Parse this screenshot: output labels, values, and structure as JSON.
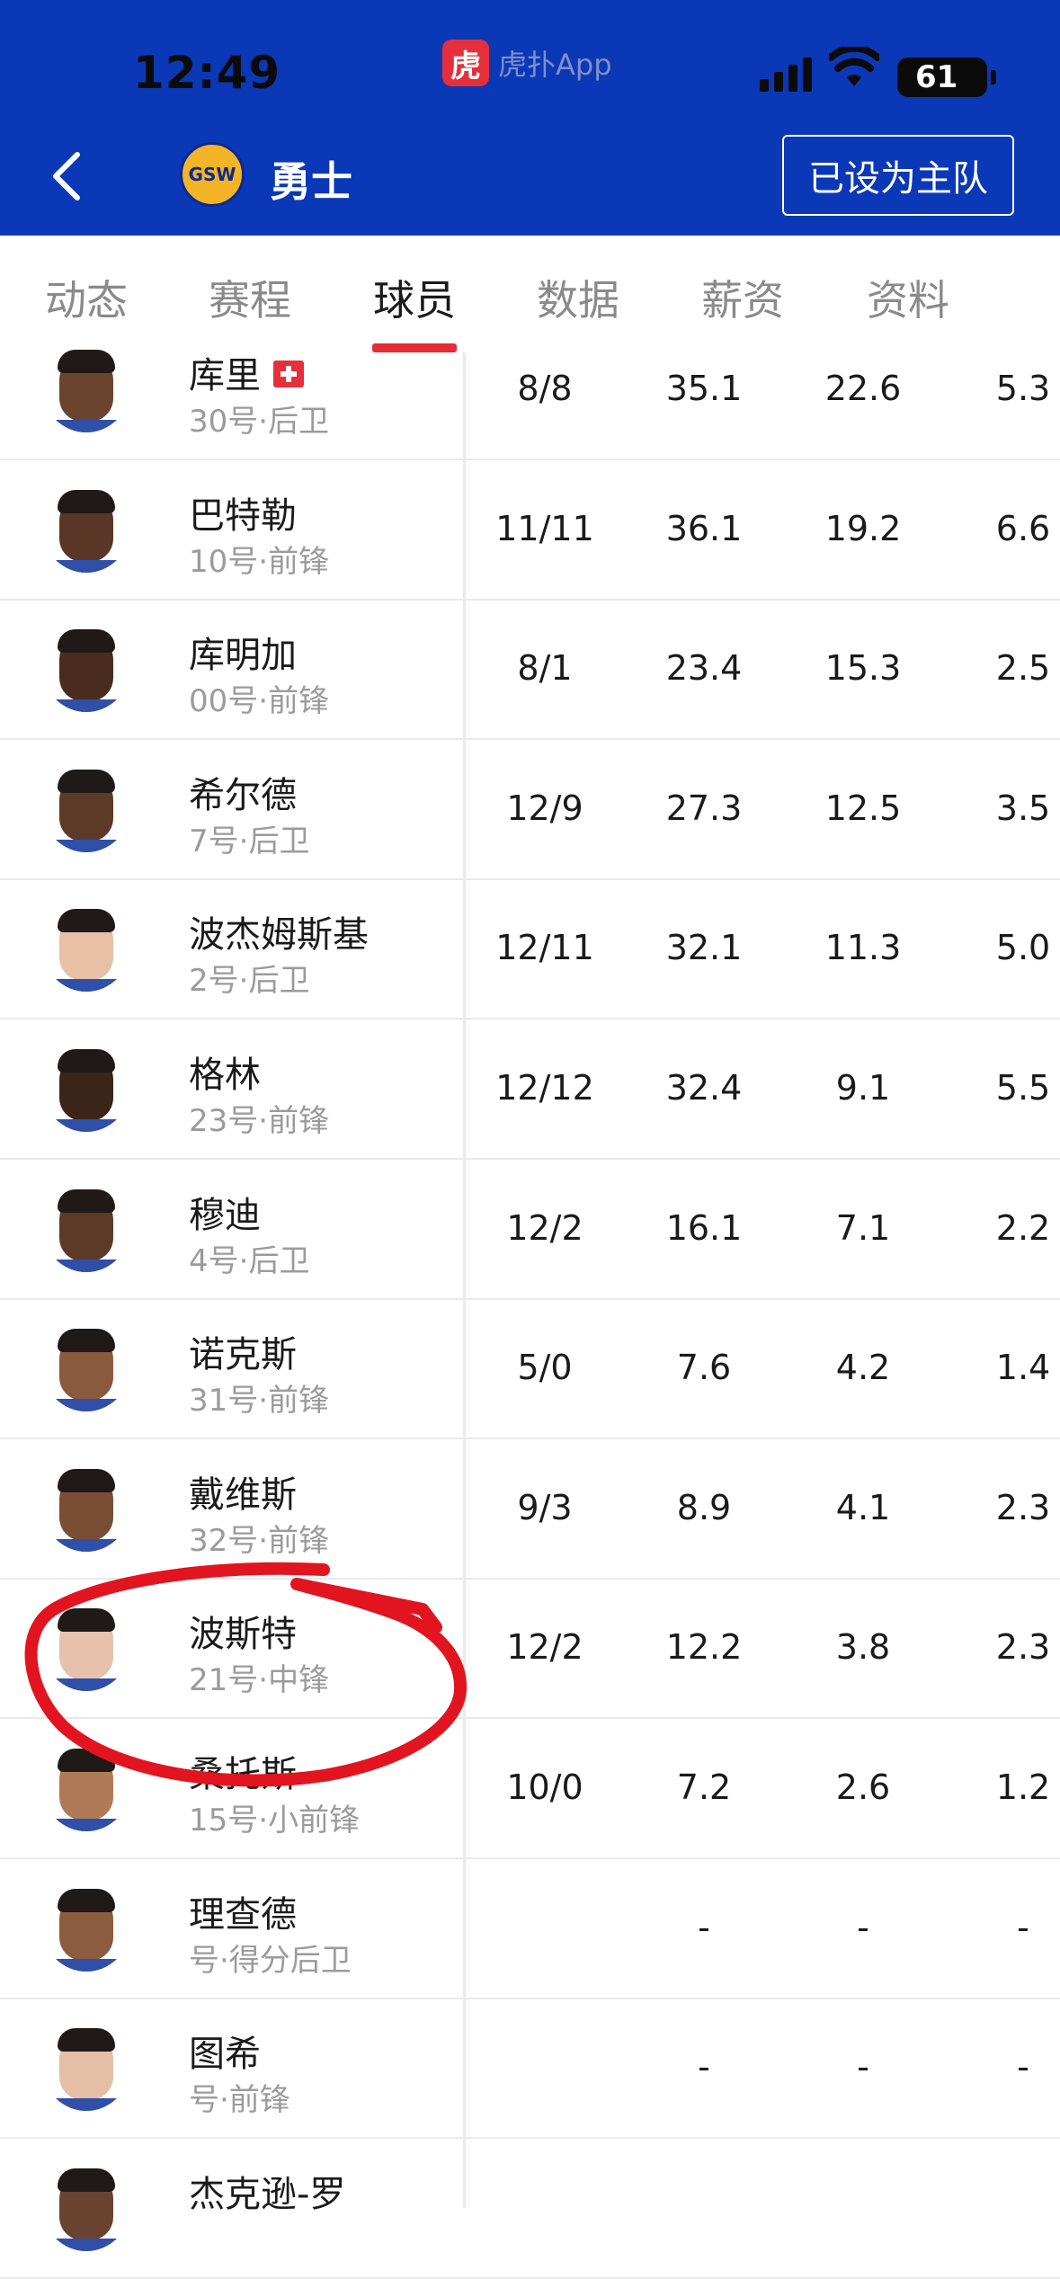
{
  "status_bar": {
    "time": "12:49",
    "app_name": "虎扑App",
    "app_logo_char": "虎",
    "battery": "61"
  },
  "header": {
    "team_name": "勇士",
    "team_logo_text": "GSW",
    "home_button": "已设为主队"
  },
  "tabs": [
    "动态",
    "赛程",
    "球员",
    "数据",
    "薪资",
    "资料"
  ],
  "active_tab": 2,
  "players": [
    {
      "name": "库里",
      "meta": "30号·后卫",
      "games": "8/8",
      "min": "35.1",
      "pts": "22.6",
      "reb": "5.3",
      "injury": true,
      "skin": "#6b4430"
    },
    {
      "name": "巴特勒",
      "meta": "10号·前锋",
      "games": "11/11",
      "min": "36.1",
      "pts": "19.2",
      "reb": "6.6",
      "skin": "#5a3626"
    },
    {
      "name": "库明加",
      "meta": "00号·前锋",
      "games": "8/1",
      "min": "23.4",
      "pts": "15.3",
      "reb": "2.5",
      "skin": "#4a2c1e"
    },
    {
      "name": "希尔德",
      "meta": "7号·后卫",
      "games": "12/9",
      "min": "27.3",
      "pts": "12.5",
      "reb": "3.5",
      "skin": "#5c3a28"
    },
    {
      "name": "波杰姆斯基",
      "meta": "2号·后卫",
      "games": "12/11",
      "min": "32.1",
      "pts": "11.3",
      "reb": "5.0",
      "skin": "#e8c0a6"
    },
    {
      "name": "格林",
      "meta": "23号·前锋",
      "games": "12/12",
      "min": "32.4",
      "pts": "9.1",
      "reb": "5.5",
      "skin": "#3b2418"
    },
    {
      "name": "穆迪",
      "meta": "4号·后卫",
      "games": "12/2",
      "min": "16.1",
      "pts": "7.1",
      "reb": "2.2",
      "skin": "#5b3a27"
    },
    {
      "name": "诺克斯",
      "meta": "31号·前锋",
      "games": "5/0",
      "min": "7.6",
      "pts": "4.2",
      "reb": "1.4",
      "skin": "#8a5a3e"
    },
    {
      "name": "戴维斯",
      "meta": "32号·前锋",
      "games": "9/3",
      "min": "8.9",
      "pts": "4.1",
      "reb": "2.3",
      "skin": "#7a4e34"
    },
    {
      "name": "波斯特",
      "meta": "21号·中锋",
      "games": "12/2",
      "min": "12.2",
      "pts": "3.8",
      "reb": "2.3",
      "skin": "#e6c2ac"
    },
    {
      "name": "桑托斯",
      "meta": "15号·小前锋",
      "games": "10/0",
      "min": "7.2",
      "pts": "2.6",
      "reb": "1.2",
      "skin": "#b07a56"
    },
    {
      "name": "理查德",
      "meta": "号·得分后卫",
      "games": "",
      "min": "-",
      "pts": "-",
      "reb": "-",
      "skin": "#8c5c3e"
    },
    {
      "name": "图希",
      "meta": "号·前锋",
      "games": "",
      "min": "-",
      "pts": "-",
      "reb": "-",
      "skin": "#e4bfa6"
    },
    {
      "name": "杰克逊-罗",
      "meta": "",
      "games": "",
      "min": "",
      "pts": "",
      "reb": "",
      "skin": "#6a4330"
    }
  ]
}
